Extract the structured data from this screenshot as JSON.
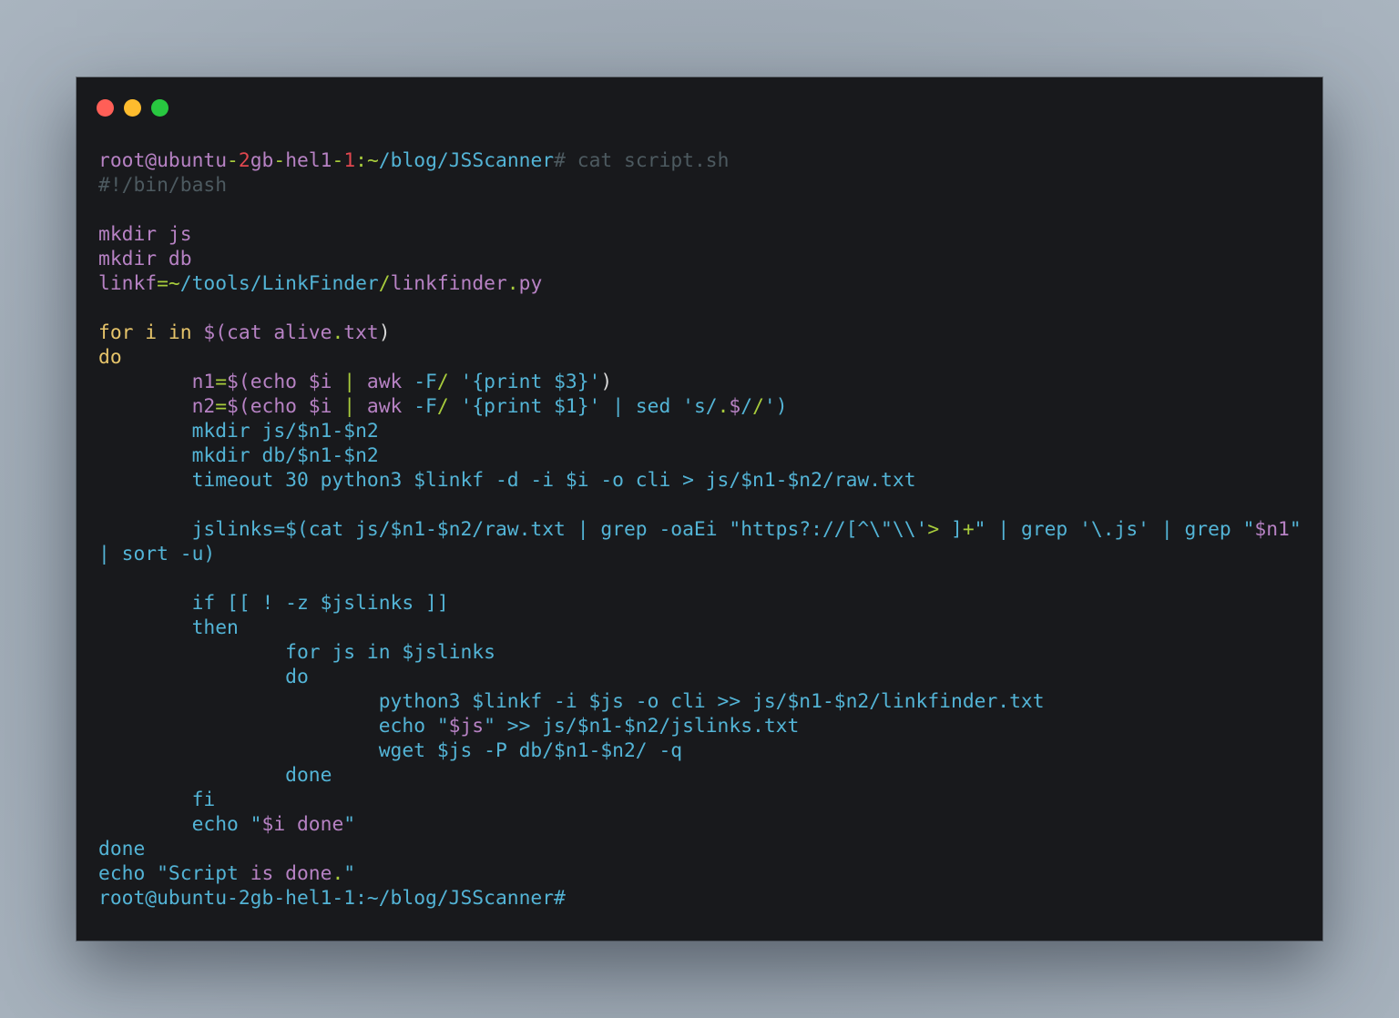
{
  "window": {
    "controls": {
      "close": "close-icon",
      "minimize": "minimize-icon",
      "maximize": "maximize-icon"
    },
    "colors": {
      "close": "#ff5f57",
      "minimize": "#febc2e",
      "maximize": "#28c840",
      "background": "#18191c"
    }
  },
  "terminal": {
    "prompt": "root@ubuntu-2gb-hel1-1:~/blog/JSScanner#",
    "command": "cat script.sh",
    "lines": [
      [
        {
          "t": "root@ubuntu",
          "c": "purple"
        },
        {
          "t": "-",
          "c": "green"
        },
        {
          "t": "2",
          "c": "red"
        },
        {
          "t": "gb",
          "c": "purple"
        },
        {
          "t": "-",
          "c": "green"
        },
        {
          "t": "hel1",
          "c": "purple"
        },
        {
          "t": "-",
          "c": "green"
        },
        {
          "t": "1",
          "c": "red"
        },
        {
          "t": ":~",
          "c": "green"
        },
        {
          "t": "/blog/JSScanner",
          "c": "blue"
        },
        {
          "t": "# cat script.sh",
          "c": "gray"
        }
      ],
      [
        {
          "t": "#!/bin/bash",
          "c": "gray"
        }
      ],
      [],
      [
        {
          "t": "mkdir js",
          "c": "purple"
        }
      ],
      [
        {
          "t": "mkdir db",
          "c": "purple"
        }
      ],
      [
        {
          "t": "linkf",
          "c": "purple"
        },
        {
          "t": "=~",
          "c": "green"
        },
        {
          "t": "/tools/LinkFinder",
          "c": "blue"
        },
        {
          "t": "/",
          "c": "green"
        },
        {
          "t": "linkfinder",
          "c": "purple"
        },
        {
          "t": ".",
          "c": "green"
        },
        {
          "t": "py",
          "c": "purple"
        }
      ],
      [],
      [
        {
          "t": "for i in ",
          "c": "yellow"
        },
        {
          "t": "$(cat alive",
          "c": "purple"
        },
        {
          "t": ".",
          "c": "green"
        },
        {
          "t": "txt",
          "c": "purple"
        },
        {
          "t": ")",
          "c": "white"
        }
      ],
      [
        {
          "t": "do",
          "c": "yellow"
        }
      ],
      [
        {
          "t": "        n1",
          "c": "purple"
        },
        {
          "t": "=",
          "c": "green"
        },
        {
          "t": "$(echo $i ",
          "c": "purple"
        },
        {
          "t": "|",
          "c": "green"
        },
        {
          "t": " awk ",
          "c": "purple"
        },
        {
          "t": "-F",
          "c": "blue"
        },
        {
          "t": "/",
          "c": "green"
        },
        {
          "t": " '{print $3}'",
          "c": "blue"
        },
        {
          "t": ")",
          "c": "white"
        }
      ],
      [
        {
          "t": "        n2",
          "c": "purple"
        },
        {
          "t": "=",
          "c": "green"
        },
        {
          "t": "$(echo $i ",
          "c": "purple"
        },
        {
          "t": "|",
          "c": "green"
        },
        {
          "t": " awk ",
          "c": "purple"
        },
        {
          "t": "-F",
          "c": "blue"
        },
        {
          "t": "/",
          "c": "green"
        },
        {
          "t": " '{print $1}' | sed 's/",
          "c": "blue"
        },
        {
          "t": ".",
          "c": "green"
        },
        {
          "t": "$",
          "c": "purple"
        },
        {
          "t": "/",
          "c": "blue"
        },
        {
          "t": "/",
          "c": "green"
        },
        {
          "t": "')",
          "c": "blue"
        }
      ],
      [
        {
          "t": "        mkdir js/$n1-$n2",
          "c": "blue"
        }
      ],
      [
        {
          "t": "        mkdir db/$n1-$n2",
          "c": "blue"
        }
      ],
      [
        {
          "t": "        timeout 30 python3 $linkf -d -i $i -o cli > js/$n1-$n2/raw.txt",
          "c": "blue"
        }
      ],
      [],
      [
        {
          "t": "        jslinks=$(cat js/$n1-$n2/raw.txt | grep -oaEi \"https?://[^\\\"\\\\'",
          "c": "blue"
        },
        {
          "t": ">",
          "c": "green"
        },
        {
          "t": " ]",
          "c": "blue"
        },
        {
          "t": "+",
          "c": "green"
        },
        {
          "t": "\" | grep '\\.js' | grep \"",
          "c": "blue"
        },
        {
          "t": "$n1",
          "c": "purple"
        },
        {
          "t": "\"",
          "c": "blue"
        }
      ],
      [
        {
          "t": "| sort -u)",
          "c": "blue"
        }
      ],
      [],
      [
        {
          "t": "        if [[ ! -z $jslinks ]]",
          "c": "blue"
        }
      ],
      [
        {
          "t": "        then",
          "c": "blue"
        }
      ],
      [
        {
          "t": "                for js in $jslinks",
          "c": "blue"
        }
      ],
      [
        {
          "t": "                do",
          "c": "blue"
        }
      ],
      [
        {
          "t": "                        python3 $linkf -i $js -o cli >> js/$n1-$n2/linkfinder.txt",
          "c": "blue"
        }
      ],
      [
        {
          "t": "                        echo \"",
          "c": "blue"
        },
        {
          "t": "$js",
          "c": "purple"
        },
        {
          "t": "\" >> js/$n1-$n2/jslinks.txt",
          "c": "blue"
        }
      ],
      [
        {
          "t": "                        wget $js -P db/$n1-$n2/ -q",
          "c": "blue"
        }
      ],
      [
        {
          "t": "                done",
          "c": "blue"
        }
      ],
      [
        {
          "t": "        fi",
          "c": "blue"
        }
      ],
      [
        {
          "t": "        echo \"",
          "c": "blue"
        },
        {
          "t": "$i done",
          "c": "purple"
        },
        {
          "t": "\"",
          "c": "blue"
        }
      ],
      [
        {
          "t": "done",
          "c": "blue"
        }
      ],
      [
        {
          "t": "echo \"Script ",
          "c": "blue"
        },
        {
          "t": "is done",
          "c": "purple"
        },
        {
          "t": ".",
          "c": "green"
        },
        {
          "t": "\"",
          "c": "blue"
        }
      ],
      [
        {
          "t": "root@ubuntu-2gb-hel1-1:~/blog/JSScanner#",
          "c": "blue"
        }
      ]
    ]
  }
}
